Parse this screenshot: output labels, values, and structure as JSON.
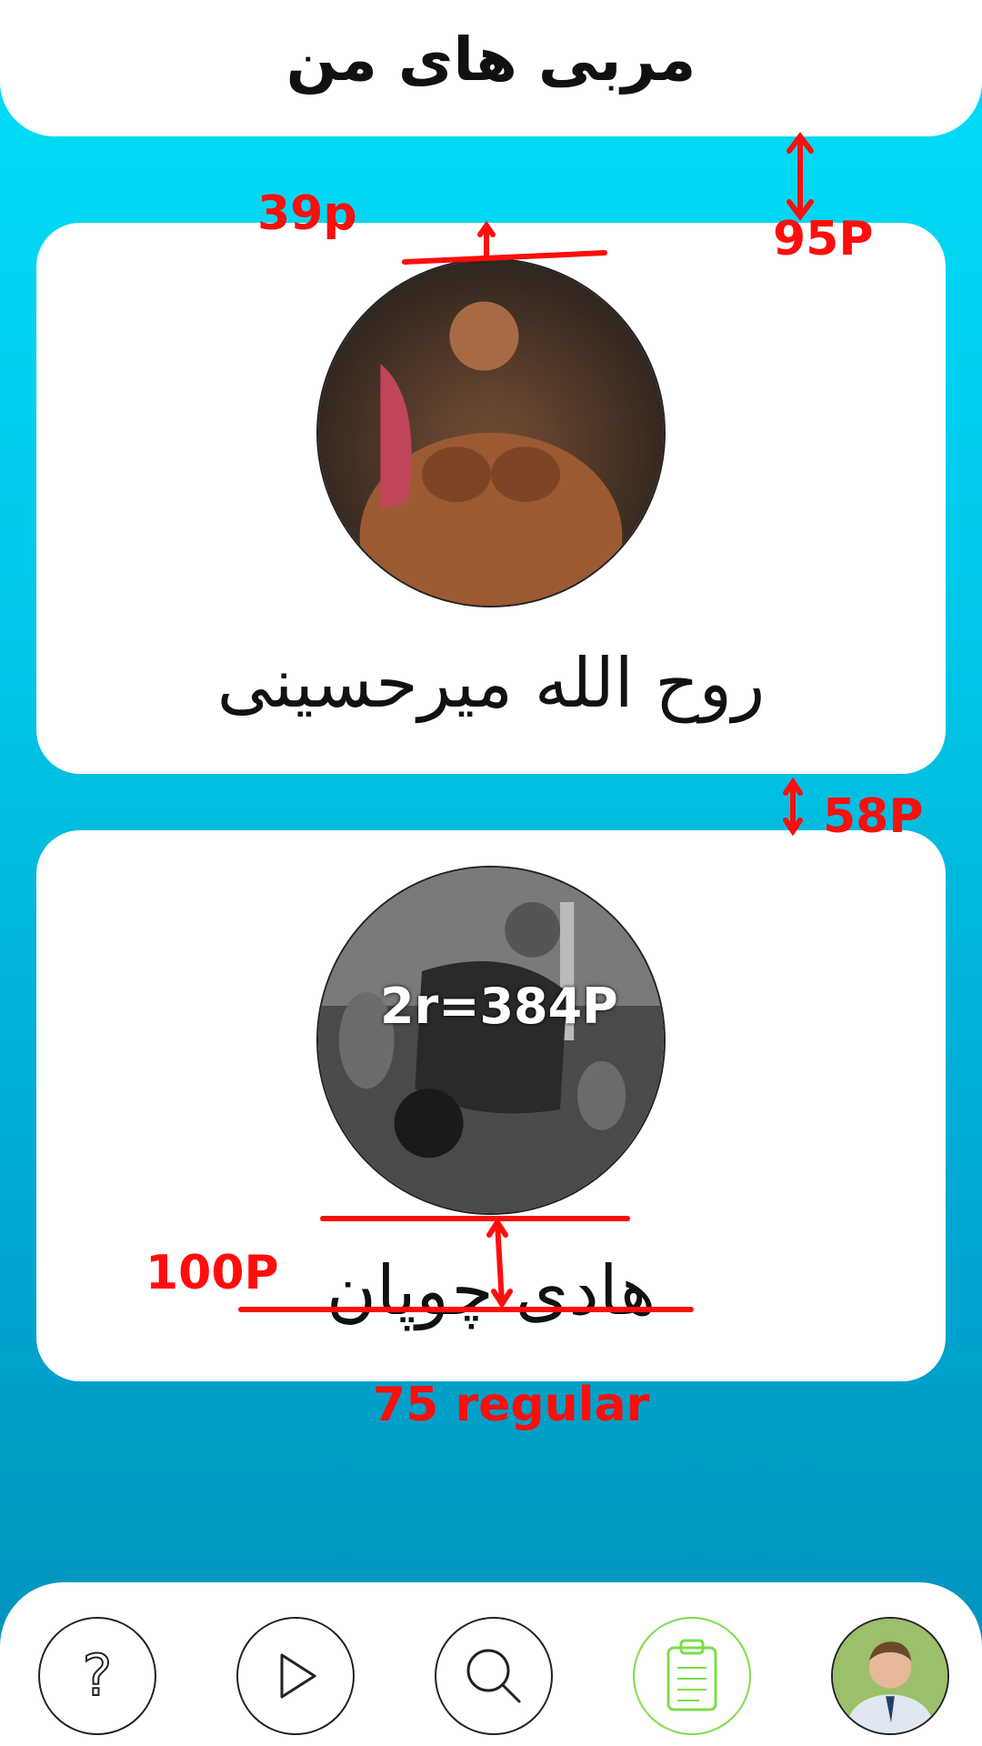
{
  "header": {
    "title": "مربی های من"
  },
  "coaches": [
    {
      "name": "روح الله میرحسینی"
    },
    {
      "name": "هادی چوپان"
    }
  ],
  "annotations": {
    "a39": "39p",
    "a95": "95P",
    "a58": "58P",
    "a2r": "2r=384P",
    "a100": "100P",
    "a75": "75 regular"
  },
  "nav": {
    "items": [
      {
        "icon": "help-icon"
      },
      {
        "icon": "play-icon"
      },
      {
        "icon": "search-icon"
      },
      {
        "icon": "clipboard-icon",
        "active": true
      },
      {
        "icon": "profile-avatar"
      }
    ]
  },
  "colors": {
    "accent": "#00c8e8",
    "annotation": "#ff0d0d",
    "active_nav": "#7ddc4a"
  }
}
